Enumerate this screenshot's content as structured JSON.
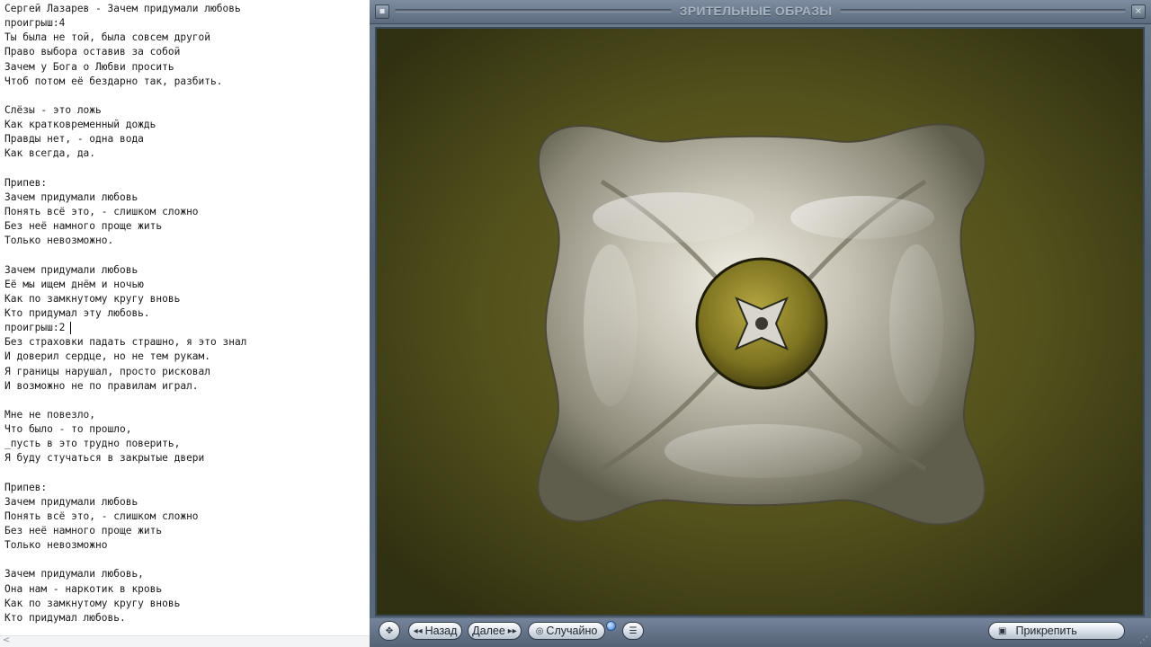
{
  "editor": {
    "lines": [
      "Сергей Лазарев - Зачем придумали любовь",
      "проигрыш:4",
      "Ты была не той, была совсем другой",
      "Право выбора оставив за собой",
      "Зачем у Бога о Любви просить",
      "Чтоб потом её бездарно так, разбить.",
      "",
      "Слёзы - это ложь",
      "Как кратковременный дождь",
      "Правды нет, - одна вода",
      "Как всегда, да.",
      "",
      "Припев:",
      "Зачем придумали любовь",
      "Понять всё это, - слишком сложно",
      "Без неё намного проще жить",
      "Только невозможно.",
      "",
      "Зачем придумали любовь",
      "Её мы ищем днём и ночью",
      "Как по замкнутому кругу вновь",
      "Кто придумал эту любовь.",
      "проигрыш:2",
      "Без страховки падать страшно, я это знал",
      "И доверил сердце, но не тем рукам.",
      "Я границы нарушал, просто рисковал",
      "И возможно не по правилам играл.",
      "",
      "Мне не повезло,",
      "Что было - то прошло,",
      "_пусть в это трудно поверить,",
      "Я буду стучаться в закрытые двери",
      "",
      "Припев:",
      "Зачем придумали любовь",
      "Понять всё это, - слишком сложно",
      "Без неё намного проще жить",
      "Только невозможно",
      "",
      "Зачем придумали любовь,",
      "Она нам - наркотик в кровь",
      "Как по замкнутому кругу вновь",
      "Кто придумал любовь."
    ],
    "scroll_arrow": "<"
  },
  "visualizer": {
    "title": "ЗРИТЕЛЬНЫЕ ОБРАЗЫ",
    "icons": {
      "menu": "window-menu-icon",
      "close": "close-icon"
    },
    "colors": {
      "background": "#3a3a14",
      "chrome": "#5c6b7e",
      "metal": "#c9c5b8",
      "center": "#8a7e28"
    }
  },
  "controls": {
    "nav_icon": "✥",
    "back_label": "Назад",
    "back_icon": "◂◂",
    "next_label": "Далее",
    "next_icon": "▸▸",
    "random_label": "Случайно",
    "random_icon": "◎",
    "options_icon": "☰",
    "pin_label": "Прикрепить",
    "pin_icon": "▣",
    "grip": "⋰"
  }
}
